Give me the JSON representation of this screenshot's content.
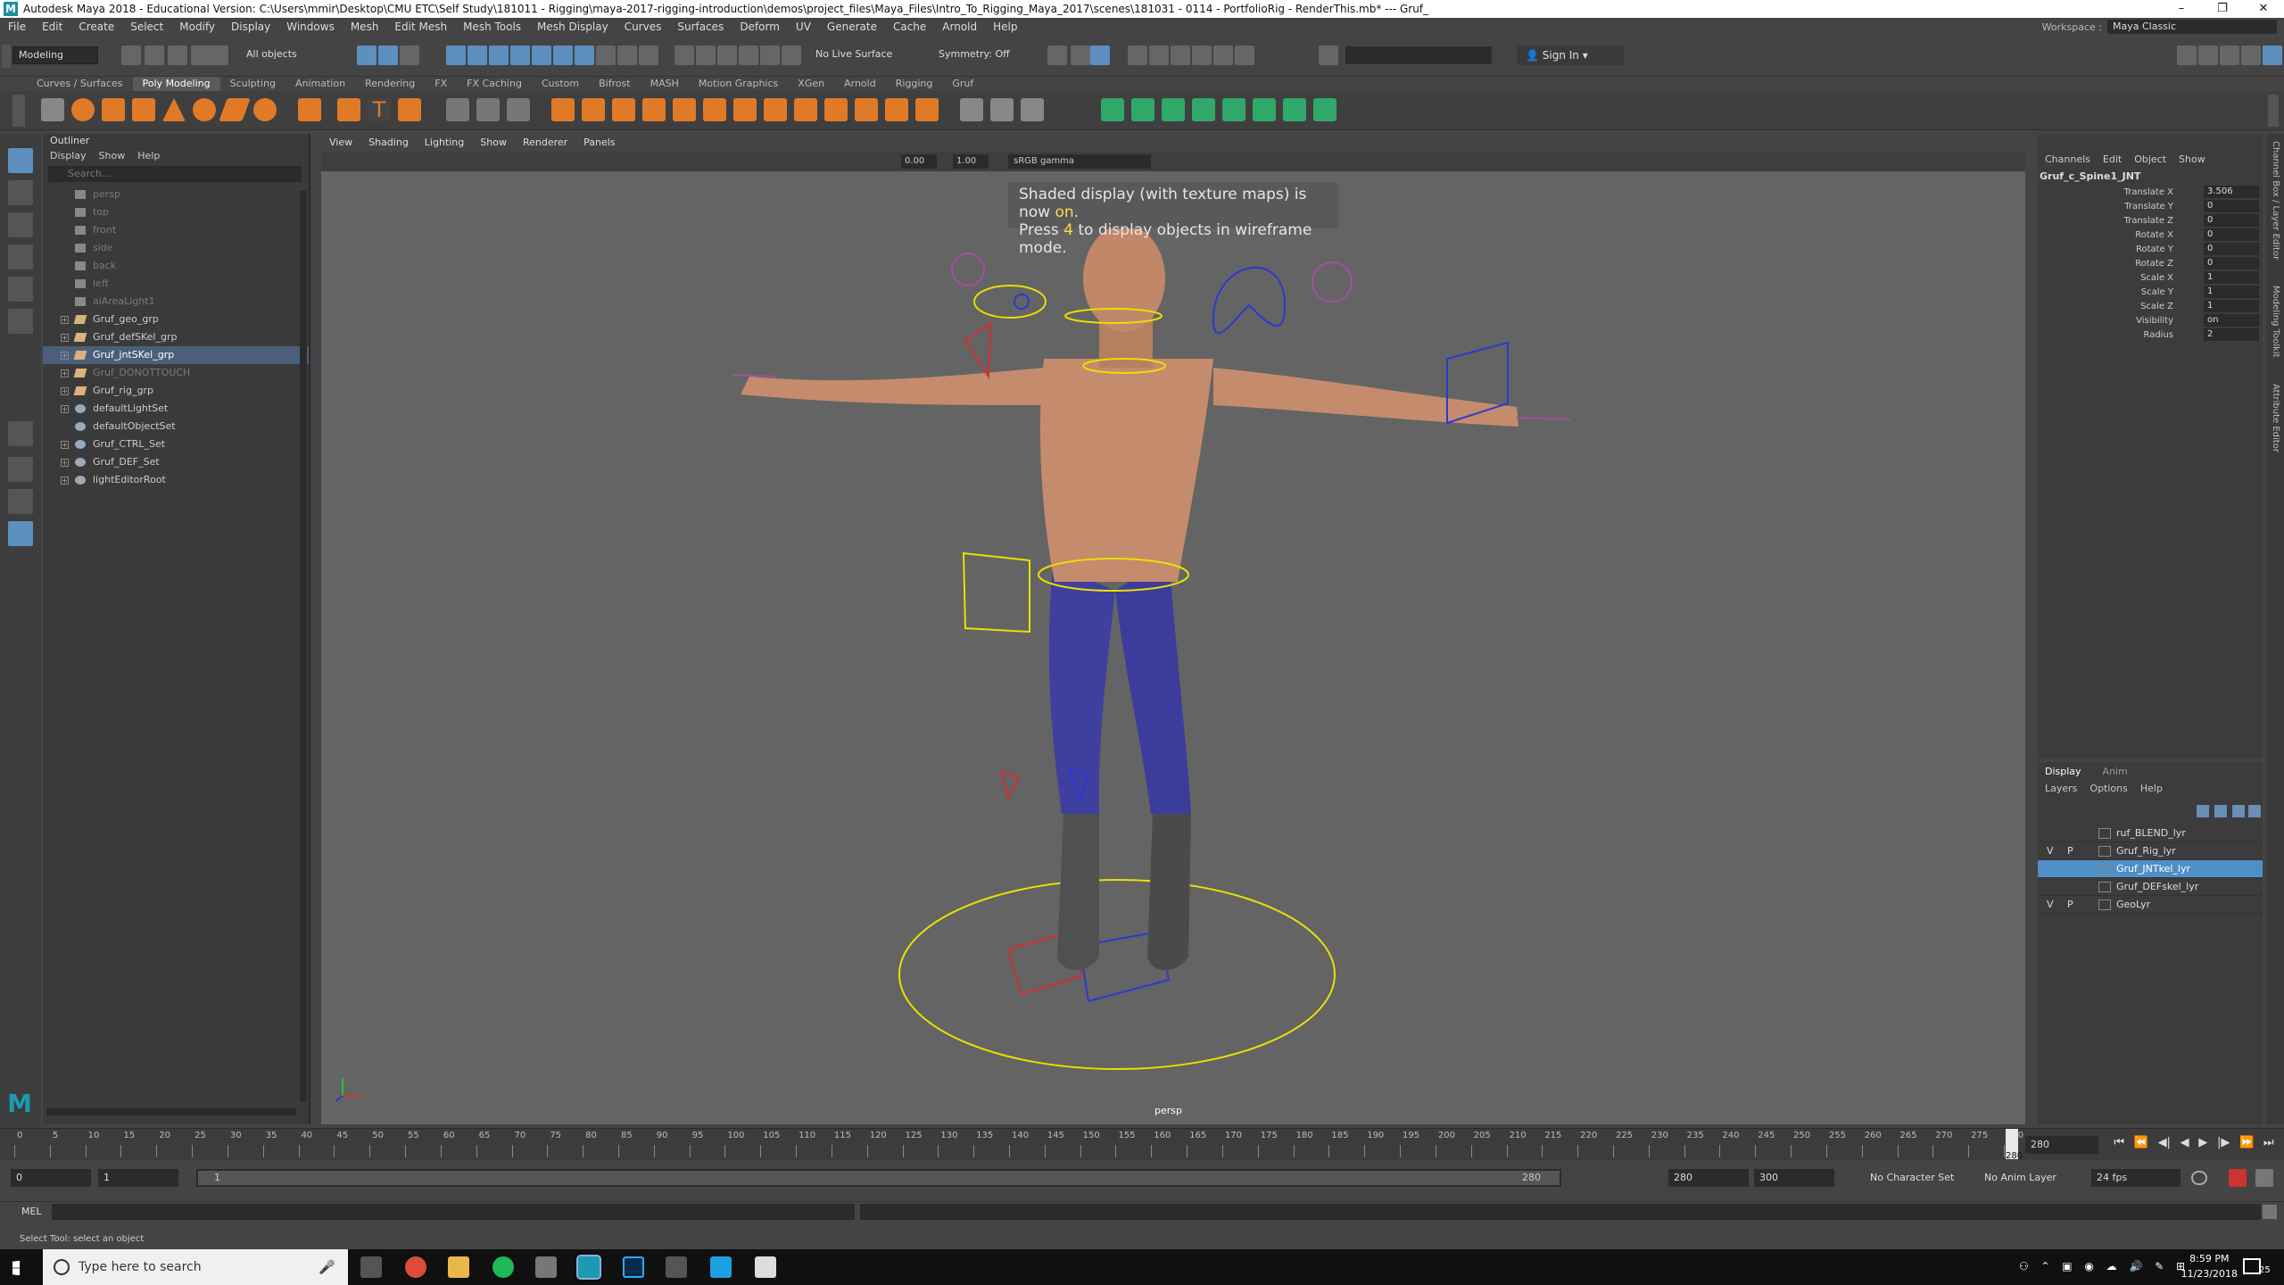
{
  "titlebar": {
    "title": "Autodesk Maya 2018 - Educational Version: C:\\Users\\mmir\\Desktop\\CMU ETC\\Self Study\\181011 - Rigging\\maya-2017-rigging-introduction\\demos\\project_files\\Maya_Files\\Intro_To_Rigging_Maya_2017\\scenes\\181031 - 0114 - PortfolioRig - RenderThis.mb* --- Gruf_"
  },
  "menubar": {
    "items": [
      "File",
      "Edit",
      "Create",
      "Select",
      "Modify",
      "Display",
      "Windows",
      "Mesh",
      "Edit Mesh",
      "Mesh Tools",
      "Mesh Display",
      "Curves",
      "Surfaces",
      "Deform",
      "UV",
      "Generate",
      "Cache",
      "Arnold",
      "Help"
    ],
    "workspace_label": "Workspace :",
    "workspace_value": "Maya Classic"
  },
  "statusline": {
    "mode": "Modeling",
    "selection_mask": "All objects",
    "live_surface": "No Live Surface",
    "symmetry": "Symmetry: Off",
    "sign_in": "Sign In"
  },
  "shelf": {
    "tabs": [
      "Curves / Surfaces",
      "Poly Modeling",
      "Sculpting",
      "Animation",
      "Rendering",
      "FX",
      "FX Caching",
      "Custom",
      "Bifrost",
      "MASH",
      "Motion Graphics",
      "XGen",
      "Arnold",
      "Rigging",
      "Gruf"
    ],
    "active_tab": "Poly Modeling"
  },
  "outliner": {
    "title": "Outliner",
    "menu": [
      "Display",
      "Show",
      "Help"
    ],
    "search_placeholder": "Search...",
    "items": [
      {
        "label": "persp",
        "icon": "camera-icon",
        "dim": true,
        "expandable": false
      },
      {
        "label": "top",
        "icon": "camera-icon",
        "dim": true,
        "expandable": false
      },
      {
        "label": "front",
        "icon": "camera-icon",
        "dim": true,
        "expandable": false
      },
      {
        "label": "side",
        "icon": "camera-icon",
        "dim": true,
        "expandable": false
      },
      {
        "label": "back",
        "icon": "camera-icon",
        "dim": true,
        "expandable": false
      },
      {
        "label": "left",
        "icon": "camera-icon",
        "dim": true,
        "expandable": false
      },
      {
        "label": "aiAreaLight1",
        "icon": "light-icon",
        "dim": true,
        "expandable": false
      },
      {
        "label": "Gruf_geo_grp",
        "icon": "group-icon",
        "dim": false,
        "expandable": true
      },
      {
        "label": "Gruf_defSKel_grp",
        "icon": "group-icon",
        "dim": false,
        "expandable": true
      },
      {
        "label": "Gruf_jntSKel_grp",
        "icon": "group-icon",
        "dim": false,
        "expandable": true,
        "selected": true
      },
      {
        "label": "Gruf_DONOTTOUCH",
        "icon": "group-icon",
        "dim": true,
        "expandable": true
      },
      {
        "label": "Gruf_rig_grp",
        "icon": "group-icon",
        "dim": false,
        "expandable": true
      },
      {
        "label": "defaultLightSet",
        "icon": "set-icon",
        "dim": false,
        "expandable": true
      },
      {
        "label": "defaultObjectSet",
        "icon": "set-icon",
        "dim": false,
        "expandable": false
      },
      {
        "label": "Gruf_CTRL_Set",
        "icon": "set-icon",
        "dim": false,
        "expandable": true
      },
      {
        "label": "Gruf_DEF_Set",
        "icon": "set-icon",
        "dim": false,
        "expandable": true
      },
      {
        "label": "lightEditorRoot",
        "icon": "set-icon",
        "dim": false,
        "expandable": true
      }
    ]
  },
  "viewport": {
    "menu": [
      "View",
      "Shading",
      "Lighting",
      "Show",
      "Renderer",
      "Panels"
    ],
    "near_value": "0.00",
    "far_value": "1.00",
    "color_space": "sRGB gamma",
    "hud_line1_pre": "Shaded display (with texture maps) is now ",
    "hud_line1_on": "on",
    "hud_line1_post": ".",
    "hud_line2_pre": "Press ",
    "hud_line2_key": "4",
    "hud_line2_post": " to display objects in wireframe mode.",
    "camera_label": "persp"
  },
  "channelbox": {
    "menu": [
      "Channels",
      "Edit",
      "Object",
      "Show"
    ],
    "object_name": "Gruf_c_Spine1_JNT",
    "channels": [
      {
        "label": "Translate X",
        "value": "3.506"
      },
      {
        "label": "Translate Y",
        "value": "0"
      },
      {
        "label": "Translate Z",
        "value": "0"
      },
      {
        "label": "Rotate X",
        "value": "0"
      },
      {
        "label": "Rotate Y",
        "value": "0"
      },
      {
        "label": "Rotate Z",
        "value": "0"
      },
      {
        "label": "Scale X",
        "value": "1"
      },
      {
        "label": "Scale Y",
        "value": "1"
      },
      {
        "label": "Scale Z",
        "value": "1"
      },
      {
        "label": "Visibility",
        "value": "on"
      },
      {
        "label": "Radius",
        "value": "2"
      }
    ]
  },
  "layereditor": {
    "tabs": [
      "Display",
      "Anim"
    ],
    "active_tab": "Display",
    "menu": [
      "Layers",
      "Options",
      "Help"
    ],
    "layers": [
      {
        "v": "",
        "p": "",
        "name": "ruf_BLEND_lyr",
        "selected": false
      },
      {
        "v": "V",
        "p": "P",
        "name": "Gruf_Rig_lyr",
        "selected": false
      },
      {
        "v": "",
        "p": "",
        "name": "Gruf_JNTkel_lyr",
        "selected": true
      },
      {
        "v": "",
        "p": "",
        "name": "Gruf_DEFskel_lyr",
        "selected": false
      },
      {
        "v": "V",
        "p": "P",
        "name": "GeoLyr",
        "selected": false
      }
    ]
  },
  "vtabs": [
    "Channel Box / Layer Editor",
    "Modeling Toolkit",
    "Attribute Editor"
  ],
  "timeline": {
    "ticks": [
      "0",
      "5",
      "10",
      "15",
      "20",
      "25",
      "30",
      "35",
      "40",
      "45",
      "50",
      "55",
      "60",
      "65",
      "70",
      "75",
      "80",
      "85",
      "90",
      "95",
      "100",
      "105",
      "110",
      "115",
      "120",
      "125",
      "130",
      "135",
      "140",
      "145",
      "150",
      "155",
      "160",
      "165",
      "170",
      "175",
      "180",
      "185",
      "190",
      "195",
      "200",
      "205",
      "210",
      "215",
      "220",
      "225",
      "230",
      "235",
      "240",
      "245",
      "250",
      "255",
      "260",
      "265",
      "270",
      "275",
      "280"
    ],
    "current_frame": "280",
    "current_frame_marker": "280"
  },
  "rangebar": {
    "start": "0",
    "playback_start": "1",
    "range_start_label": "1",
    "range_end_label": "280",
    "playback_end": "280",
    "end": "300",
    "character_set": "No Character Set",
    "anim_layer": "No Anim Layer",
    "fps": "24 fps"
  },
  "cmdline": {
    "label": "MEL"
  },
  "helpline": {
    "text": "Select Tool: select an object"
  },
  "taskbar": {
    "search_placeholder": "Type here to search",
    "time": "8:59 PM",
    "date": "11/23/2018",
    "notification_count": "25"
  }
}
